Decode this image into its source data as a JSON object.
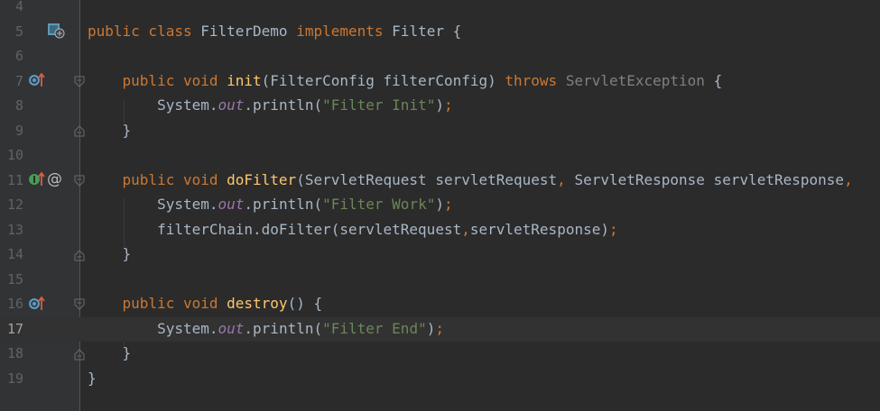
{
  "editor": {
    "colors": {
      "background": "#2b2b2b",
      "gutter": "#313335",
      "keyword": "#cc7832",
      "method": "#ffc66d",
      "string": "#6a8759",
      "static_field": "#9876aa",
      "text": "#a9b7c6",
      "line_number": "#606366"
    },
    "current_line": "17",
    "lines": [
      {
        "num": "4",
        "parts": []
      },
      {
        "num": "5",
        "parts": [
          {
            "t": "public class ",
            "c": "kw"
          },
          {
            "t": "FilterDemo ",
            "c": ""
          },
          {
            "t": "implements ",
            "c": "kw"
          },
          {
            "t": "Filter {",
            "c": ""
          }
        ]
      },
      {
        "num": "6",
        "parts": []
      },
      {
        "num": "7",
        "parts": [
          {
            "t": "    public void ",
            "c": "kw"
          },
          {
            "t": "init",
            "c": "fn"
          },
          {
            "t": "(FilterConfig filterConfig) ",
            "c": ""
          },
          {
            "t": "throws ",
            "c": "kw"
          },
          {
            "t": "ServletException ",
            "c": "dim"
          },
          {
            "t": "{",
            "c": ""
          }
        ]
      },
      {
        "num": "8",
        "parts": [
          {
            "t": "        System.",
            "c": ""
          },
          {
            "t": "out",
            "c": "it"
          },
          {
            "t": ".println(",
            "c": ""
          },
          {
            "t": "\"Filter Init\"",
            "c": "st"
          },
          {
            "t": ")",
            "c": ""
          },
          {
            "t": ";",
            "c": "sep"
          }
        ]
      },
      {
        "num": "9",
        "parts": [
          {
            "t": "    }",
            "c": ""
          }
        ]
      },
      {
        "num": "10",
        "parts": []
      },
      {
        "num": "11",
        "parts": [
          {
            "t": "    public void ",
            "c": "kw"
          },
          {
            "t": "doFilter",
            "c": "fn"
          },
          {
            "t": "(ServletRequest servletRequest",
            "c": ""
          },
          {
            "t": ", ",
            "c": "sep"
          },
          {
            "t": "ServletResponse servletResponse",
            "c": ""
          },
          {
            "t": ",",
            "c": "sep"
          }
        ]
      },
      {
        "num": "12",
        "parts": [
          {
            "t": "        System.",
            "c": ""
          },
          {
            "t": "out",
            "c": "it"
          },
          {
            "t": ".println(",
            "c": ""
          },
          {
            "t": "\"Filter Work\"",
            "c": "st"
          },
          {
            "t": ")",
            "c": ""
          },
          {
            "t": ";",
            "c": "sep"
          }
        ]
      },
      {
        "num": "13",
        "parts": [
          {
            "t": "        filterChain.doFilter(servletRequest",
            "c": ""
          },
          {
            "t": ",",
            "c": "sep"
          },
          {
            "t": "servletResponse)",
            "c": ""
          },
          {
            "t": ";",
            "c": "sep"
          }
        ]
      },
      {
        "num": "14",
        "parts": [
          {
            "t": "    }",
            "c": ""
          }
        ]
      },
      {
        "num": "15",
        "parts": []
      },
      {
        "num": "16",
        "parts": [
          {
            "t": "    public void ",
            "c": "kw"
          },
          {
            "t": "destroy",
            "c": "fn"
          },
          {
            "t": "() {",
            "c": ""
          }
        ]
      },
      {
        "num": "17",
        "parts": [
          {
            "t": "        System.",
            "c": ""
          },
          {
            "t": "out",
            "c": "it"
          },
          {
            "t": ".println(",
            "c": ""
          },
          {
            "t": "\"Filter End\"",
            "c": "st"
          },
          {
            "t": ")",
            "c": ""
          },
          {
            "t": ";",
            "c": "sep"
          }
        ]
      },
      {
        "num": "18",
        "parts": [
          {
            "t": "    }",
            "c": ""
          }
        ]
      },
      {
        "num": "19",
        "parts": [
          {
            "t": "}",
            "c": ""
          }
        ]
      }
    ]
  }
}
